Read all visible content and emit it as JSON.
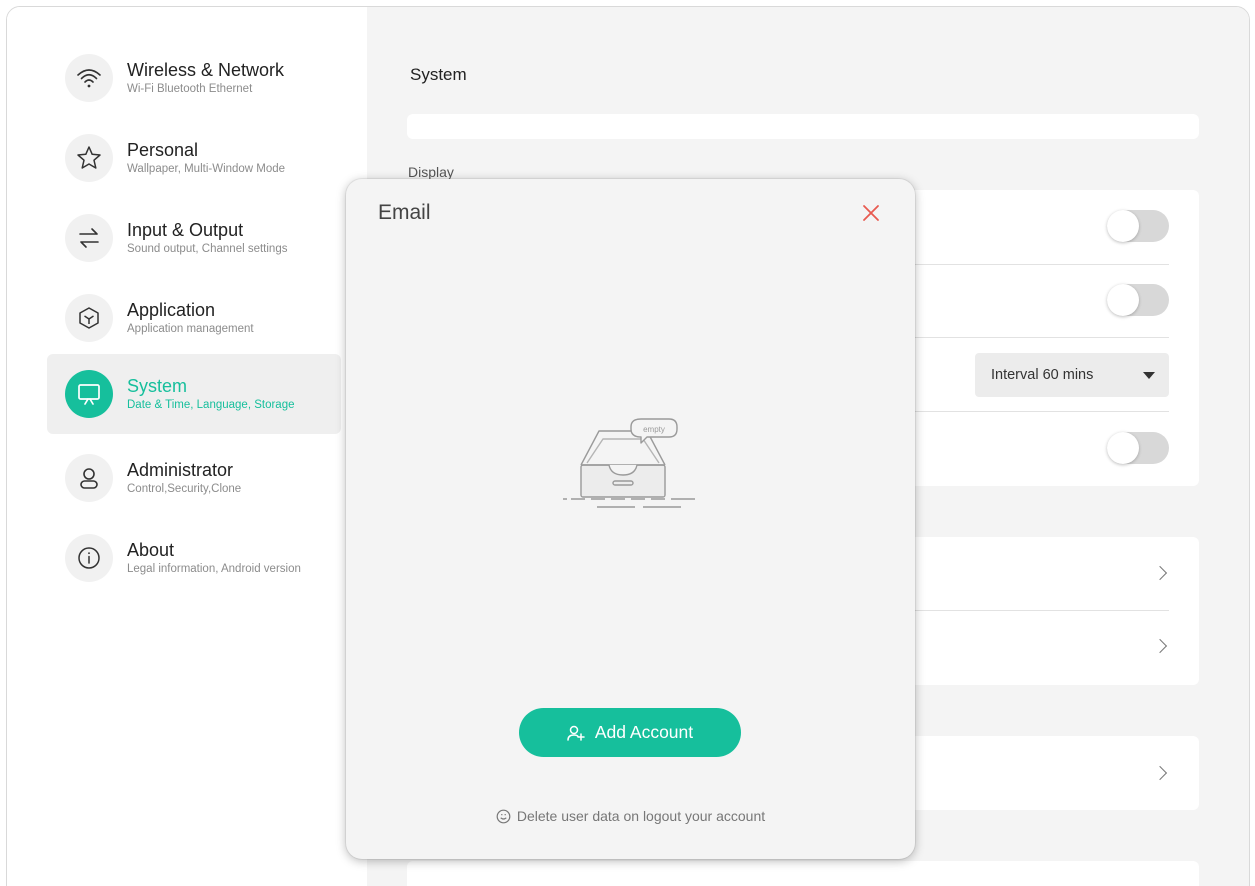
{
  "sidebar": {
    "items": [
      {
        "title": "Wireless & Network",
        "subtitle": "Wi-Fi Bluetooth Ethernet",
        "icon": "wifi-icon"
      },
      {
        "title": "Personal",
        "subtitle": "Wallpaper, Multi-Window Mode",
        "icon": "star-icon"
      },
      {
        "title": "Input & Output",
        "subtitle": "Sound output, Channel settings",
        "icon": "swap-arrows-icon"
      },
      {
        "title": "Application",
        "subtitle": "Application management",
        "icon": "cube-icon"
      },
      {
        "title": "System",
        "subtitle": "Date & Time, Language, Storage",
        "icon": "monitor-icon",
        "active": true
      },
      {
        "title": "Administrator",
        "subtitle": "Control,Security,Clone",
        "icon": "user-icon"
      },
      {
        "title": "About",
        "subtitle": "Legal information, Android version",
        "icon": "info-icon"
      }
    ]
  },
  "main": {
    "title": "System",
    "display_label": "Display",
    "interval_select": "Interval 60 mins"
  },
  "modal": {
    "title": "Email",
    "empty_bubble": "empty",
    "add_button": "Add Account",
    "footnote": "Delete user data on logout your account"
  },
  "colors": {
    "accent": "#16bf9c",
    "close": "#e85a50"
  }
}
